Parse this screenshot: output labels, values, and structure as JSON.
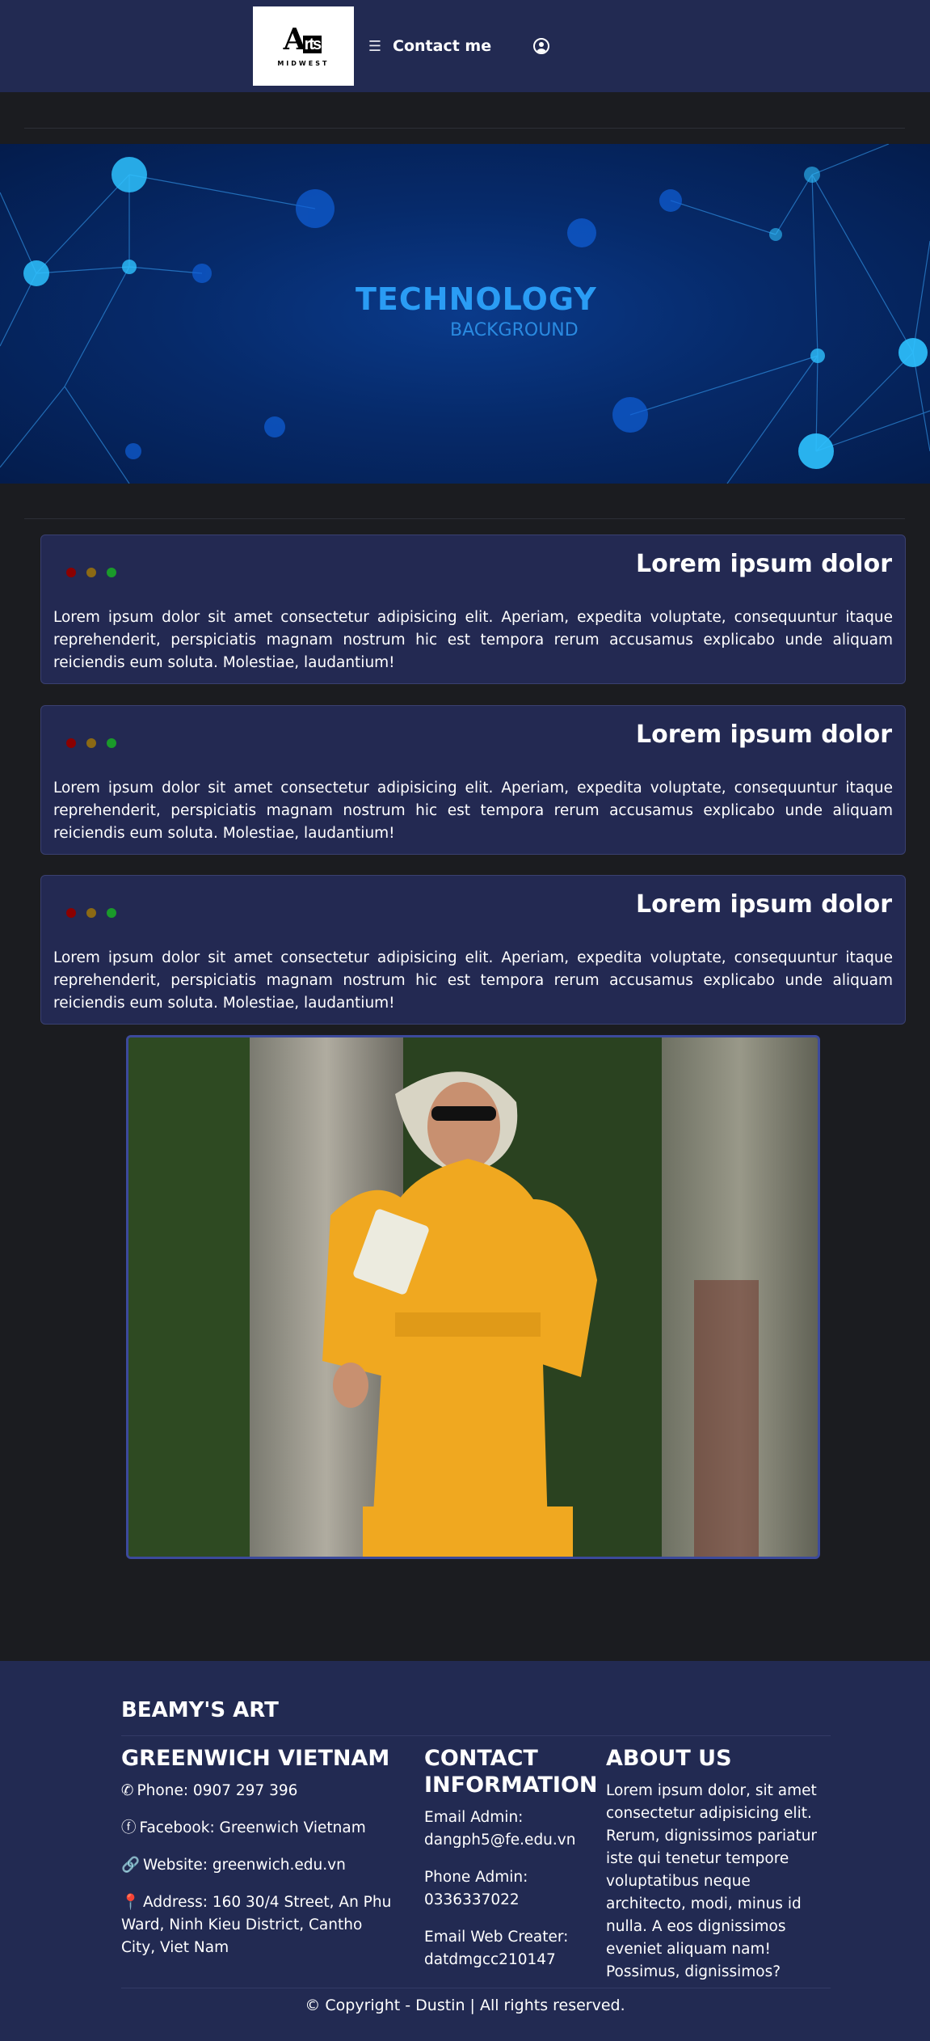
{
  "nav": {
    "logo_mark": "A",
    "logo_mark_suffix": "rts",
    "logo_sub": "MIDWEST",
    "contact_label": "Contact me"
  },
  "banner": {
    "title": "TECHNOLOGY",
    "subtitle": "BACKGROUND"
  },
  "cards": [
    {
      "title": "Lorem ipsum dolor",
      "body": "Lorem ipsum dolor sit amet consectetur adipisicing elit. Aperiam, expedita voluptate, consequuntur itaque reprehenderit, perspiciatis magnam nostrum hic est tempora rerum accusamus explicabo unde aliquam reiciendis eum soluta. Molestiae, laudantium!"
    },
    {
      "title": "Lorem ipsum dolor",
      "body": "Lorem ipsum dolor sit amet consectetur adipisicing elit. Aperiam, expedita voluptate, consequuntur itaque reprehenderit, perspiciatis magnam nostrum hic est tempora rerum accusamus explicabo unde aliquam reiciendis eum soluta. Molestiae, laudantium!"
    },
    {
      "title": "Lorem ipsum dolor",
      "body": "Lorem ipsum dolor sit amet consectetur adipisicing elit. Aperiam, expedita voluptate, consequuntur itaque reprehenderit, perspiciatis magnam nostrum hic est tempora rerum accusamus explicabo unde aliquam reiciendis eum soluta. Molestiae, laudantium!"
    }
  ],
  "dot_colors": [
    "#8b0000",
    "#8b6914",
    "#1a9a2a"
  ],
  "footer": {
    "brand": "BEAMY'S ART",
    "greenwich": {
      "title": "GREENWICH VIETNAM",
      "phone": "Phone: 0907 297 396",
      "facebook": "Facebook: Greenwich Vietnam",
      "website": "Website: greenwich.edu.vn",
      "address": "Address: 160 30/4 Street, An Phu Ward, Ninh Kieu District, Cantho City, Viet Nam"
    },
    "contact": {
      "title": "CONTACT INFORMATION",
      "email_admin_label": "Email Admin:",
      "email_admin": "dangph5@fe.edu.vn",
      "phone_admin_label": "Phone Admin:",
      "phone_admin": "0336337022",
      "email_creator_label": "Email Web Creater:",
      "email_creator": "datdmgcc210147"
    },
    "about": {
      "title": "ABOUT US",
      "body": "Lorem ipsum dolor, sit amet consectetur adipisicing elit. Rerum, dignissimos pariatur iste qui tenetur tempore voluptatibus neque architecto, modi, minus id nulla. A eos dignissimos eveniet aliquam nam! Possimus, dignissimos?"
    },
    "copyright": "© Copyright - Dustin | All rights reserved."
  }
}
